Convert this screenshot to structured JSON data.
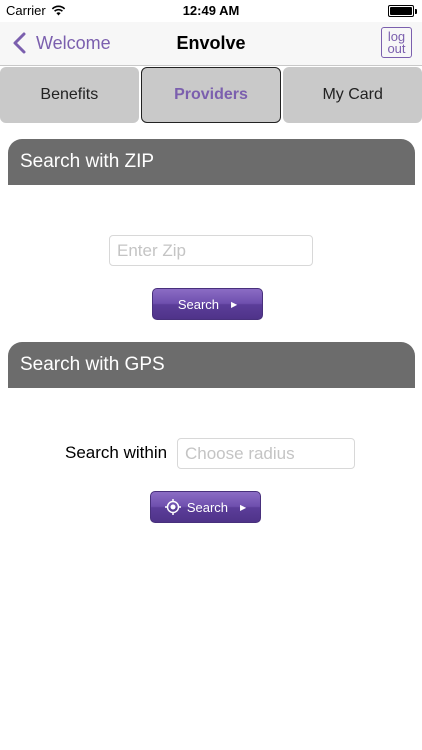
{
  "status_bar": {
    "carrier": "Carrier",
    "time": "12:49 AM",
    "wifi_icon": "wifi-icon",
    "battery_icon": "battery-icon"
  },
  "nav": {
    "back_label": "Welcome",
    "title": "Envolve",
    "logout_label": "log\nout"
  },
  "tabs": [
    {
      "label": "Benefits",
      "active": false
    },
    {
      "label": "Providers",
      "active": true
    },
    {
      "label": "My Card",
      "active": false
    }
  ],
  "zip_section": {
    "title": "Search with ZIP",
    "zip_value": "",
    "zip_placeholder": "Enter Zip",
    "search_label": "Search"
  },
  "gps_section": {
    "title": "Search with GPS",
    "within_label": "Search within",
    "radius_value": "",
    "radius_placeholder": "Choose radius",
    "search_label": "Search"
  },
  "colors": {
    "accent": "#7b5fae",
    "section_header": "#6c6c6c",
    "tab_bg": "#c9c9c9"
  }
}
